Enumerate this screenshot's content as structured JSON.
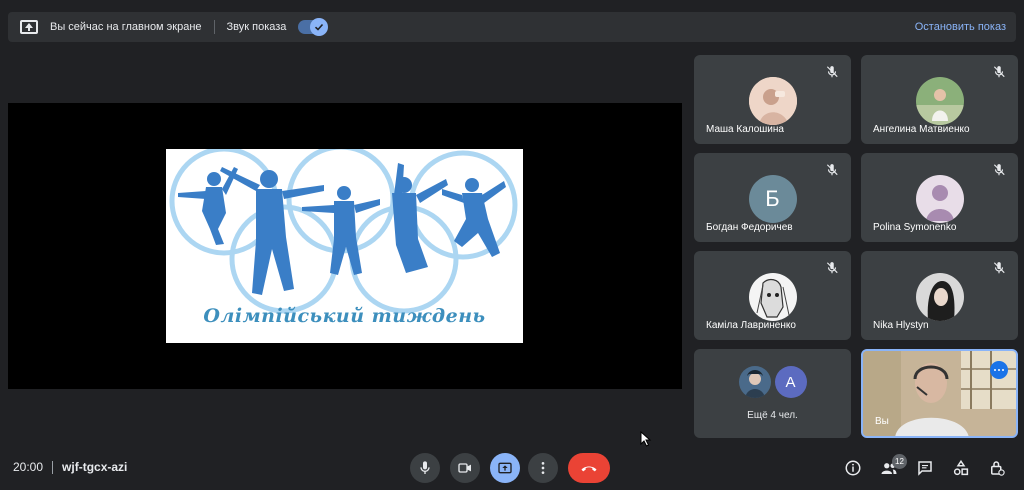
{
  "topbar": {
    "presenting_text": "Вы сейчас на главном экране",
    "sound_label": "Звук показа",
    "stop_label": "Остановить показ"
  },
  "slide": {
    "title": "Олімпійський тиждень"
  },
  "participants": [
    {
      "name": "Маша Калошина"
    },
    {
      "name": "Ангелина Матвиенко"
    },
    {
      "name": "Богдан Федоричев",
      "initial": "Б"
    },
    {
      "name": "Polina Symonenko"
    },
    {
      "name": "Каміла Лавриненко"
    },
    {
      "name": "Nika Hlystyn"
    }
  ],
  "more": {
    "label": "Ещё 4 чел.",
    "initial": "А"
  },
  "self": {
    "label": "Вы"
  },
  "bottom": {
    "time": "20:00",
    "code": "wjf-tgcx-azi",
    "participants_count": "12"
  },
  "colors": {
    "accent": "#8ab4f8",
    "hangup": "#ea4335",
    "tile": "#3c4043",
    "background": "#202124"
  },
  "icons": [
    "present-screen-icon",
    "check-icon",
    "mic-off-icon",
    "more-dots-icon",
    "mic-icon",
    "camera-icon",
    "present-icon",
    "more-vert-icon",
    "hangup-icon",
    "info-icon",
    "people-icon",
    "chat-icon",
    "activities-icon",
    "host-controls-icon"
  ]
}
